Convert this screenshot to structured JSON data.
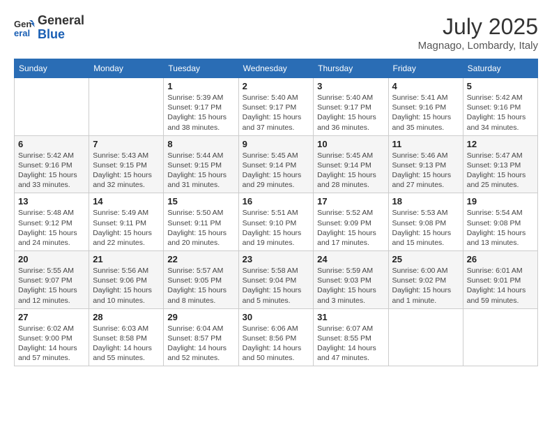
{
  "logo": {
    "line1": "General",
    "line2": "Blue"
  },
  "title": "July 2025",
  "location": "Magnago, Lombardy, Italy",
  "weekdays": [
    "Sunday",
    "Monday",
    "Tuesday",
    "Wednesday",
    "Thursday",
    "Friday",
    "Saturday"
  ],
  "weeks": [
    [
      {
        "num": "",
        "info": ""
      },
      {
        "num": "",
        "info": ""
      },
      {
        "num": "1",
        "info": "Sunrise: 5:39 AM\nSunset: 9:17 PM\nDaylight: 15 hours\nand 38 minutes."
      },
      {
        "num": "2",
        "info": "Sunrise: 5:40 AM\nSunset: 9:17 PM\nDaylight: 15 hours\nand 37 minutes."
      },
      {
        "num": "3",
        "info": "Sunrise: 5:40 AM\nSunset: 9:17 PM\nDaylight: 15 hours\nand 36 minutes."
      },
      {
        "num": "4",
        "info": "Sunrise: 5:41 AM\nSunset: 9:16 PM\nDaylight: 15 hours\nand 35 minutes."
      },
      {
        "num": "5",
        "info": "Sunrise: 5:42 AM\nSunset: 9:16 PM\nDaylight: 15 hours\nand 34 minutes."
      }
    ],
    [
      {
        "num": "6",
        "info": "Sunrise: 5:42 AM\nSunset: 9:16 PM\nDaylight: 15 hours\nand 33 minutes."
      },
      {
        "num": "7",
        "info": "Sunrise: 5:43 AM\nSunset: 9:15 PM\nDaylight: 15 hours\nand 32 minutes."
      },
      {
        "num": "8",
        "info": "Sunrise: 5:44 AM\nSunset: 9:15 PM\nDaylight: 15 hours\nand 31 minutes."
      },
      {
        "num": "9",
        "info": "Sunrise: 5:45 AM\nSunset: 9:14 PM\nDaylight: 15 hours\nand 29 minutes."
      },
      {
        "num": "10",
        "info": "Sunrise: 5:45 AM\nSunset: 9:14 PM\nDaylight: 15 hours\nand 28 minutes."
      },
      {
        "num": "11",
        "info": "Sunrise: 5:46 AM\nSunset: 9:13 PM\nDaylight: 15 hours\nand 27 minutes."
      },
      {
        "num": "12",
        "info": "Sunrise: 5:47 AM\nSunset: 9:13 PM\nDaylight: 15 hours\nand 25 minutes."
      }
    ],
    [
      {
        "num": "13",
        "info": "Sunrise: 5:48 AM\nSunset: 9:12 PM\nDaylight: 15 hours\nand 24 minutes."
      },
      {
        "num": "14",
        "info": "Sunrise: 5:49 AM\nSunset: 9:11 PM\nDaylight: 15 hours\nand 22 minutes."
      },
      {
        "num": "15",
        "info": "Sunrise: 5:50 AM\nSunset: 9:11 PM\nDaylight: 15 hours\nand 20 minutes."
      },
      {
        "num": "16",
        "info": "Sunrise: 5:51 AM\nSunset: 9:10 PM\nDaylight: 15 hours\nand 19 minutes."
      },
      {
        "num": "17",
        "info": "Sunrise: 5:52 AM\nSunset: 9:09 PM\nDaylight: 15 hours\nand 17 minutes."
      },
      {
        "num": "18",
        "info": "Sunrise: 5:53 AM\nSunset: 9:08 PM\nDaylight: 15 hours\nand 15 minutes."
      },
      {
        "num": "19",
        "info": "Sunrise: 5:54 AM\nSunset: 9:08 PM\nDaylight: 15 hours\nand 13 minutes."
      }
    ],
    [
      {
        "num": "20",
        "info": "Sunrise: 5:55 AM\nSunset: 9:07 PM\nDaylight: 15 hours\nand 12 minutes."
      },
      {
        "num": "21",
        "info": "Sunrise: 5:56 AM\nSunset: 9:06 PM\nDaylight: 15 hours\nand 10 minutes."
      },
      {
        "num": "22",
        "info": "Sunrise: 5:57 AM\nSunset: 9:05 PM\nDaylight: 15 hours\nand 8 minutes."
      },
      {
        "num": "23",
        "info": "Sunrise: 5:58 AM\nSunset: 9:04 PM\nDaylight: 15 hours\nand 5 minutes."
      },
      {
        "num": "24",
        "info": "Sunrise: 5:59 AM\nSunset: 9:03 PM\nDaylight: 15 hours\nand 3 minutes."
      },
      {
        "num": "25",
        "info": "Sunrise: 6:00 AM\nSunset: 9:02 PM\nDaylight: 15 hours\nand 1 minute."
      },
      {
        "num": "26",
        "info": "Sunrise: 6:01 AM\nSunset: 9:01 PM\nDaylight: 14 hours\nand 59 minutes."
      }
    ],
    [
      {
        "num": "27",
        "info": "Sunrise: 6:02 AM\nSunset: 9:00 PM\nDaylight: 14 hours\nand 57 minutes."
      },
      {
        "num": "28",
        "info": "Sunrise: 6:03 AM\nSunset: 8:58 PM\nDaylight: 14 hours\nand 55 minutes."
      },
      {
        "num": "29",
        "info": "Sunrise: 6:04 AM\nSunset: 8:57 PM\nDaylight: 14 hours\nand 52 minutes."
      },
      {
        "num": "30",
        "info": "Sunrise: 6:06 AM\nSunset: 8:56 PM\nDaylight: 14 hours\nand 50 minutes."
      },
      {
        "num": "31",
        "info": "Sunrise: 6:07 AM\nSunset: 8:55 PM\nDaylight: 14 hours\nand 47 minutes."
      },
      {
        "num": "",
        "info": ""
      },
      {
        "num": "",
        "info": ""
      }
    ]
  ]
}
